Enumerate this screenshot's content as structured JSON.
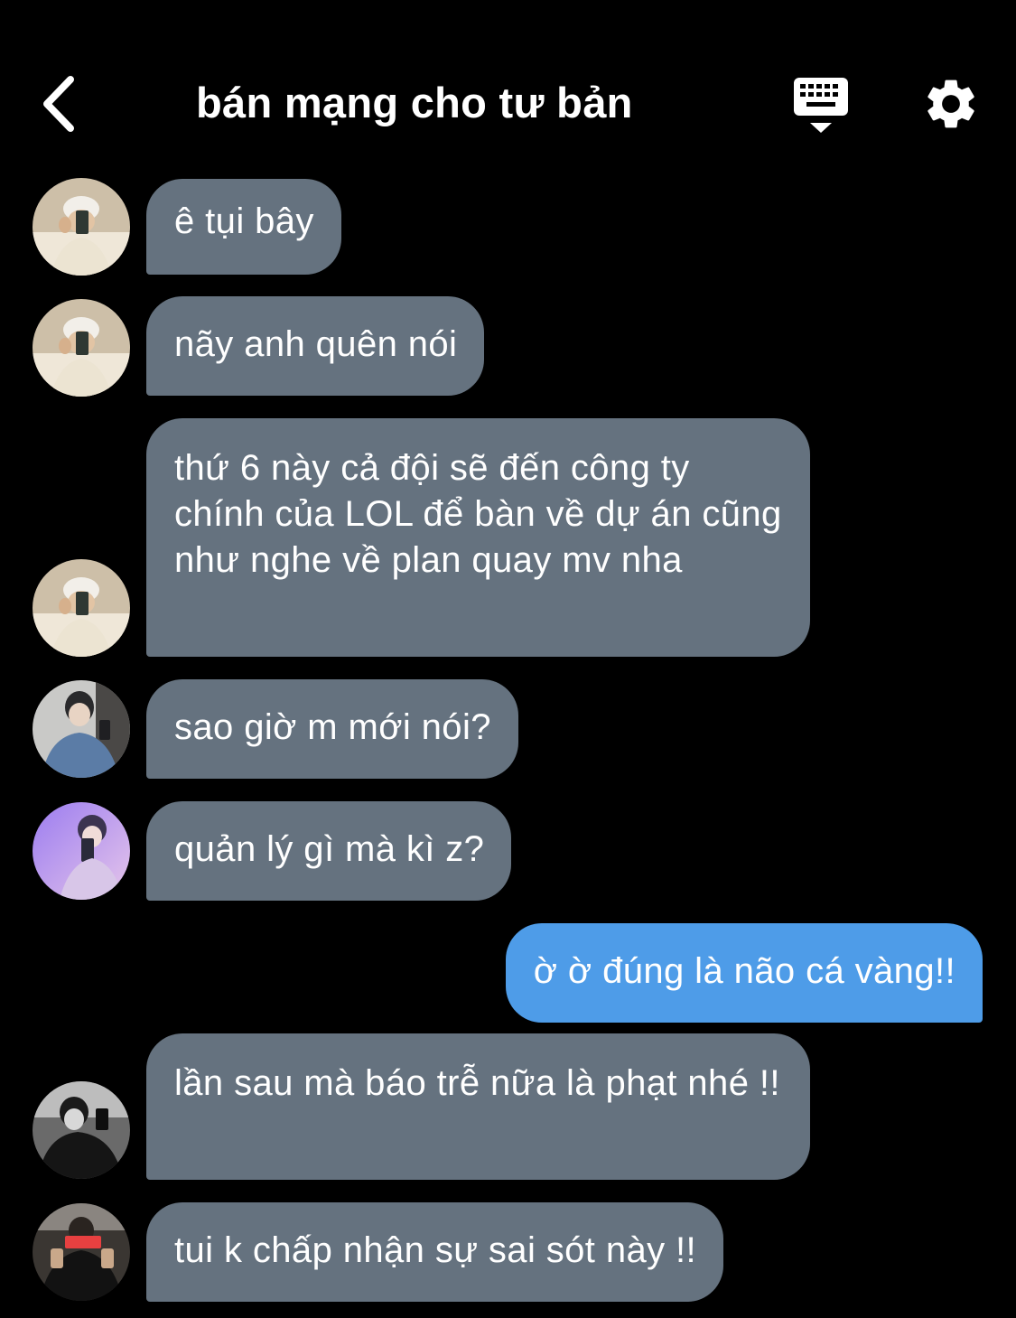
{
  "header": {
    "title": "bán mạng cho tư bản"
  },
  "colors": {
    "background": "#000000",
    "incoming_bubble": "#65727f",
    "outgoing_bubble": "#4e9ce8",
    "text": "#ffffff"
  },
  "icons": [
    "chevron-left-icon",
    "keyboard-icon",
    "gear-icon"
  ],
  "messages": [
    {
      "sender": "avatar-beanie",
      "direction": "incoming",
      "text": "ê tụi bây"
    },
    {
      "sender": "avatar-beanie",
      "direction": "incoming",
      "text": "nãy anh quên nói"
    },
    {
      "sender": "avatar-beanie",
      "direction": "incoming",
      "text": "thứ 6 này cả đội sẽ đến công ty chính của LOL để bàn về dự án cũng như nghe về plan quay mv nha"
    },
    {
      "sender": "avatar-denim",
      "direction": "incoming",
      "text": "sao giờ m mới nói?"
    },
    {
      "sender": "avatar-purple",
      "direction": "incoming",
      "text": "quản lý gì mà kì z?"
    },
    {
      "sender": "me",
      "direction": "outgoing",
      "text": "ờ ờ đúng là não cá vàng!!"
    },
    {
      "sender": "avatar-mono",
      "direction": "incoming",
      "text": "lần sau mà báo trễ nữa là phạt nhé !!"
    },
    {
      "sender": "avatar-gym",
      "direction": "incoming",
      "text": "tui k chấp nhận sự sai sót này !!"
    }
  ]
}
